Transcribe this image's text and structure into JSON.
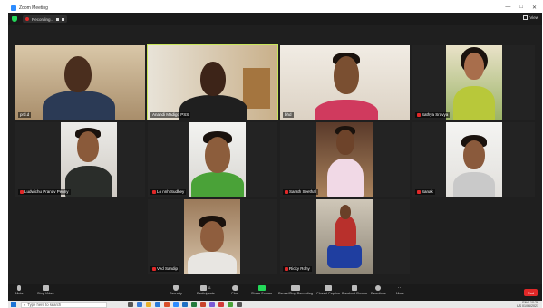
{
  "window": {
    "title": "Zoom Meeting",
    "controls": [
      "—",
      "□",
      "✕"
    ]
  },
  "topbar": {
    "recording_label": "Recording...",
    "view_label": "View"
  },
  "participants": [
    {
      "name": "prd.d"
    },
    {
      "name": "Anandi Madigo PSS"
    },
    {
      "name": "bhd"
    },
    {
      "name": "Sathya Sravya"
    },
    {
      "name": "Ludwichu Pranav Penny"
    },
    {
      "name": "Lo nnh Sudhey"
    },
    {
      "name": "Sarath Seethal"
    },
    {
      "name": "Sanak"
    },
    {
      "name": "Ved Sandip"
    },
    {
      "name": "Ricky Rohy"
    }
  ],
  "toolbar": {
    "mute": "Mute",
    "stop_video": "Stop Video",
    "security": "Security",
    "participants": "Participants",
    "participants_count": "11",
    "chat": "Chat",
    "share_screen": "Share Screen",
    "pause_recording": "Pause/Stop Recording",
    "closed_caption": "Closed Caption",
    "breakout_rooms": "Breakout Rooms",
    "reactions": "Reactions",
    "more": "More",
    "end": "End"
  },
  "taskbar": {
    "search_placeholder": "Type here to search",
    "tray_lang": "ENG",
    "tray_region": "US",
    "time": "10:26",
    "date": "01/06/2021"
  },
  "colors": {
    "active_speaker": "#c8e55a",
    "end_button": "#e02828",
    "share_screen": "#23d959",
    "zoom_blue": "#2d8cff"
  }
}
